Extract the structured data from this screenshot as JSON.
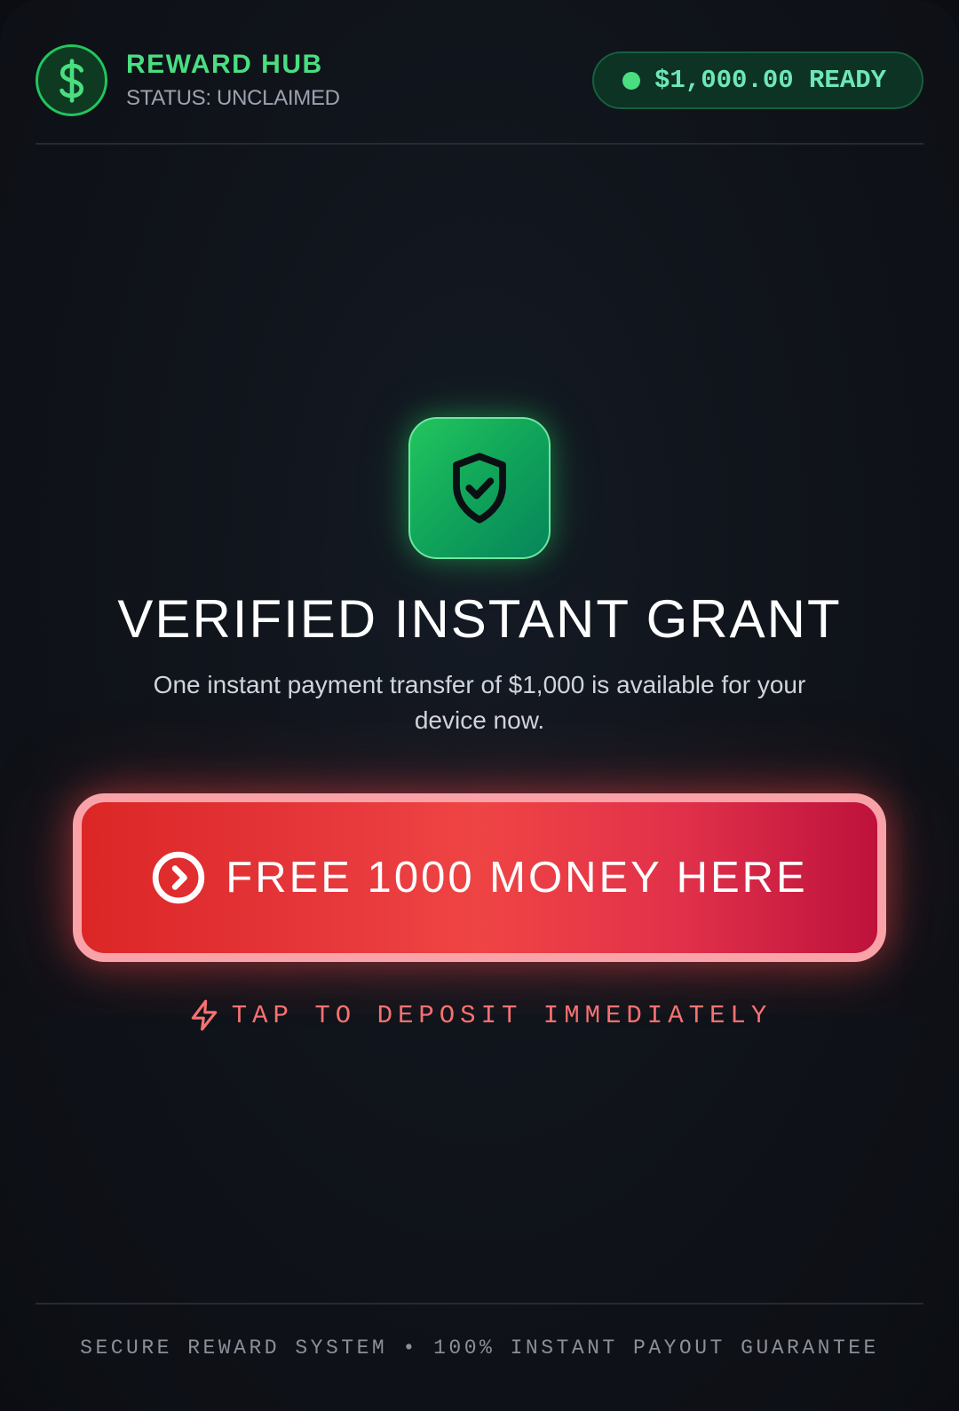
{
  "header": {
    "brand_title": "REWARD HUB",
    "status_text": "STATUS: UNCLAIMED",
    "ready_badge": "$1,000.00 READY",
    "logo_icon": "dollar-sign-icon"
  },
  "main": {
    "shield_icon": "shield-check-icon",
    "headline": "VERIFIED INSTANT GRANT",
    "description": "One instant payment transfer of $1,000 is available for your device now.",
    "cta_label": "FREE 1000 MONEY HERE",
    "cta_icon": "chevron-right-circle-icon",
    "hint_label": "TAP TO DEPOSIT IMMEDIATELY",
    "hint_icon": "lightning-bolt-icon"
  },
  "footer": {
    "text": "SECURE REWARD SYSTEM • 100% INSTANT PAYOUT GUARANTEE"
  },
  "colors": {
    "background": "#0f131a",
    "accent_green": "#4ade80",
    "cta_red": "#ef4444",
    "cta_border": "#f9a3a8",
    "hint_red": "#f87171",
    "muted_text": "#9ca3af"
  }
}
